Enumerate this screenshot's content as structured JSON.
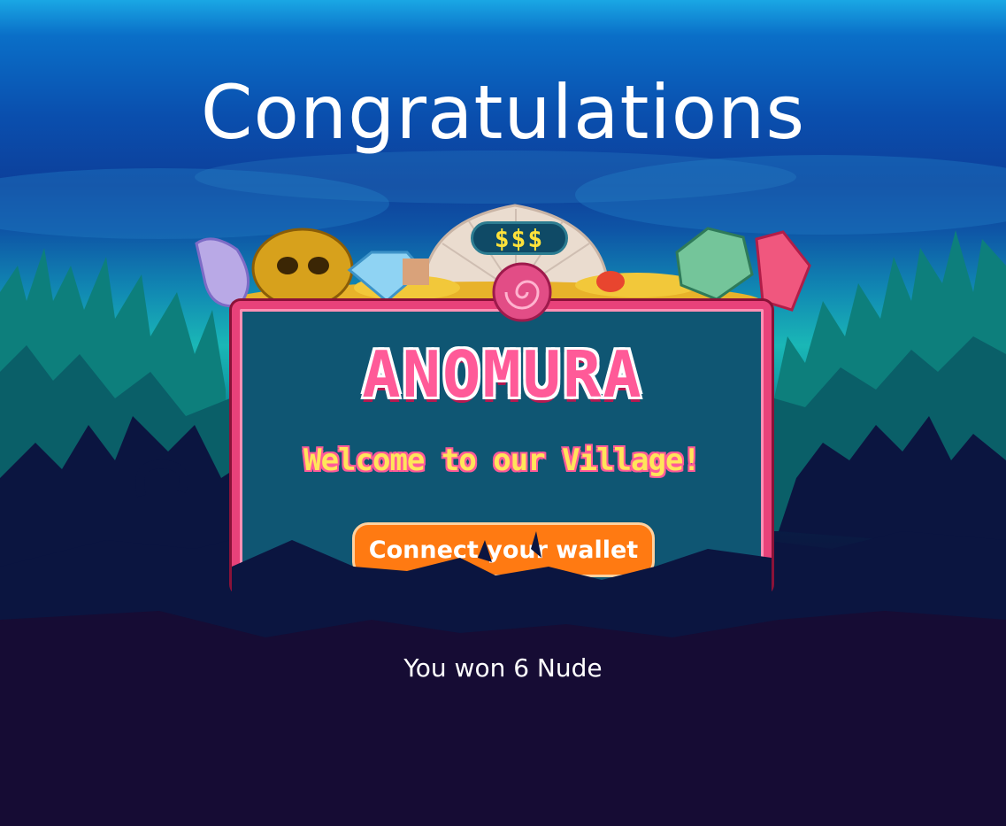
{
  "page": {
    "title": "Congratulations",
    "result_text": "You won 6 Nude"
  },
  "banner": {
    "logo_text": "ANOMURA",
    "welcome_text": "Welcome to our Village!",
    "price_tag": "$$$",
    "connect_button_label": "Connect your wallet"
  },
  "colors": {
    "accent_orange": "#ff7a12",
    "frame_pink": "#e8427a",
    "welcome_yellow": "#ffe55a",
    "panel_teal": "#0f5673",
    "deep_sea": "#1b0a2a"
  },
  "icons": [
    "shell-icon",
    "skull-icon",
    "diamond-icon",
    "gold-coins-icon",
    "emerald-icon",
    "crystal-icon",
    "spiral-shell-icon",
    "mushroom-icon"
  ]
}
